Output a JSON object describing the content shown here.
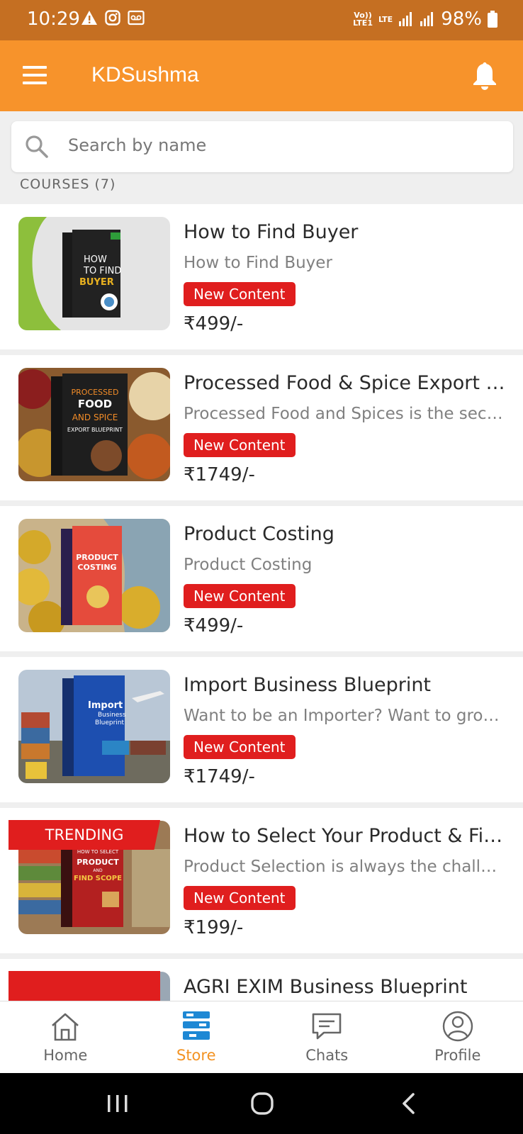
{
  "status_bar": {
    "time": "10:29",
    "battery": "98%",
    "network": "LTE",
    "icons": [
      "warning-icon",
      "instagram-icon",
      "voicemail-icon",
      "signal-icon",
      "battery-icon"
    ]
  },
  "app_bar": {
    "title": "KDSushma",
    "menu_icon": "hamburger-icon",
    "bell_icon": "bell-icon",
    "background": "#f7932b"
  },
  "search": {
    "placeholder": "Search by name",
    "icon": "search-icon"
  },
  "section": {
    "label": "COURSES (7)"
  },
  "courses": [
    {
      "title": "How to Find Buyer",
      "subtitle": "How to Find Buyer",
      "badge": "New Content",
      "price": "₹499/-",
      "thumb_text": [
        "HOW",
        "TO FIND",
        "BUYER"
      ]
    },
    {
      "title": "Processed Food & Spice Export Bl...",
      "subtitle": "Processed Food and Spices is the secto...",
      "badge": "New Content",
      "price": "₹1749/-",
      "thumb_text": [
        "PROCESSED",
        "FOOD",
        "AND SPICE",
        "EXPORT BLUEPRINT"
      ]
    },
    {
      "title": "Product Costing",
      "subtitle": "Product Costing",
      "badge": "New Content",
      "price": "₹499/-",
      "thumb_text": [
        "PRODUCT",
        "COSTING"
      ]
    },
    {
      "title": "Import Business Blueprint",
      "subtitle": "Want to be an Importer? Want to grow ...",
      "badge": "New Content",
      "price": "₹1749/-",
      "thumb_text": [
        "Import",
        "Business",
        "Blueprint"
      ]
    },
    {
      "title": "How to Select Your Product & Find...",
      "subtitle": "Product Selection is always the challen...",
      "badge": "New Content",
      "price": "₹199/-",
      "trending": "TRENDING",
      "thumb_text": [
        "HOW TO SELECT",
        "PRODUCT",
        "AND",
        "FIND SCOPE"
      ]
    },
    {
      "title": "AGRI EXIM Business Blueprint"
    }
  ],
  "bottom_nav": {
    "items": [
      {
        "label": "Home",
        "icon": "home-icon",
        "active": false
      },
      {
        "label": "Store",
        "icon": "store-icon",
        "active": true
      },
      {
        "label": "Chats",
        "icon": "chat-icon",
        "active": false
      },
      {
        "label": "Profile",
        "icon": "profile-icon",
        "active": false
      }
    ],
    "active_color": "#f39323"
  },
  "system_nav": {
    "icons": [
      "recents-icon",
      "home-circle-icon",
      "back-icon"
    ]
  },
  "colors": {
    "badge": "#e01e1e",
    "status_bar": "#c56f22"
  }
}
